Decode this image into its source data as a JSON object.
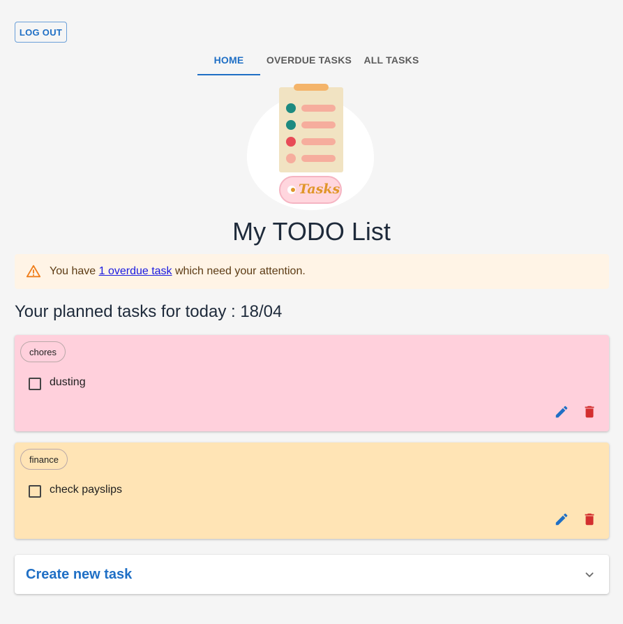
{
  "header": {
    "logout_label": "LOG OUT"
  },
  "tabs": [
    {
      "label": "HOME",
      "active": true
    },
    {
      "label": "OVERDUE TASKS",
      "active": false
    },
    {
      "label": "ALL TASKS",
      "active": false
    }
  ],
  "logo": {
    "text": "Tasks",
    "icon": "clipboard-checklist-logo"
  },
  "page": {
    "title": "My TODO List"
  },
  "alert": {
    "prefix": "You have ",
    "link": "1 overdue task",
    "suffix": " which need your attention.",
    "icon": "warning-icon"
  },
  "planned": {
    "heading": "Your planned tasks for today : 18/04"
  },
  "tasks": [
    {
      "category": "chores",
      "text": "dusting",
      "checked": false,
      "color": "#ffd0dc"
    },
    {
      "category": "finance",
      "text": "check payslips",
      "checked": false,
      "color": "#ffe4b5"
    }
  ],
  "create": {
    "label": "Create new task",
    "icon": "chevron-down-icon"
  },
  "colors": {
    "accent": "#1f6fc5",
    "delete": "#d32f2f",
    "alert_bg": "#fff4e6"
  }
}
